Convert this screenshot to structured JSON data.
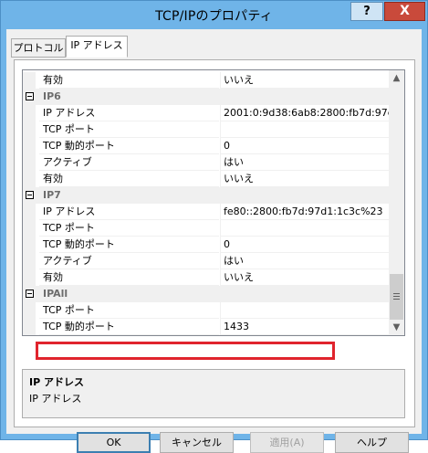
{
  "window": {
    "title": "TCP/IPのプロパティ",
    "help_label": "?",
    "close_label": "X"
  },
  "tabs": [
    {
      "label": "プロトコル",
      "active": false
    },
    {
      "label": "IP アドレス",
      "active": true
    }
  ],
  "grid": {
    "rows": [
      {
        "type": "prop",
        "name": "有効",
        "value": "いいえ"
      },
      {
        "type": "cat",
        "name": "IP6"
      },
      {
        "type": "prop",
        "name": "IP アドレス",
        "value": "2001:0:9d38:6ab8:2800:fb7d:97d"
      },
      {
        "type": "prop",
        "name": "TCP ポート",
        "value": ""
      },
      {
        "type": "prop",
        "name": "TCP 動的ポート",
        "value": "0"
      },
      {
        "type": "prop",
        "name": "アクティブ",
        "value": "はい"
      },
      {
        "type": "prop",
        "name": "有効",
        "value": "いいえ"
      },
      {
        "type": "cat",
        "name": "IP7"
      },
      {
        "type": "prop",
        "name": "IP アドレス",
        "value": "fe80::2800:fb7d:97d1:1c3c%23"
      },
      {
        "type": "prop",
        "name": "TCP ポート",
        "value": ""
      },
      {
        "type": "prop",
        "name": "TCP 動的ポート",
        "value": "0"
      },
      {
        "type": "prop",
        "name": "アクティブ",
        "value": "はい"
      },
      {
        "type": "prop",
        "name": "有効",
        "value": "いいえ"
      },
      {
        "type": "cat",
        "name": "IPAll"
      },
      {
        "type": "prop",
        "name": "TCP ポート",
        "value": ""
      },
      {
        "type": "prop",
        "name": "TCP 動的ポート",
        "value": "1433"
      }
    ]
  },
  "description": {
    "title": "IP アドレス",
    "text": "IP アドレス"
  },
  "buttons": {
    "ok": "OK",
    "cancel": "キャンセル",
    "apply": "適用(A)",
    "help": "ヘルプ"
  },
  "colors": {
    "titlebar": "#6fb4e8",
    "highlight": "#e0242d",
    "close": "#c94a3b"
  }
}
